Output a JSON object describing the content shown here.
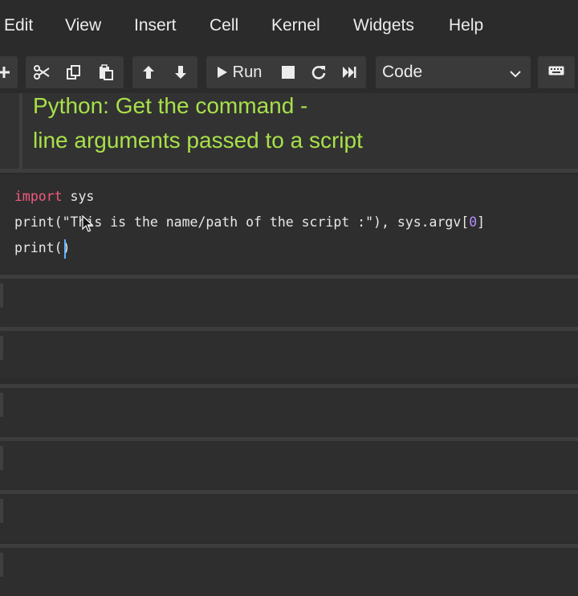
{
  "menubar": {
    "items": [
      {
        "label": "Edit"
      },
      {
        "label": "View"
      },
      {
        "label": "Insert"
      },
      {
        "label": "Cell"
      },
      {
        "label": "Kernel"
      },
      {
        "label": "Widgets"
      },
      {
        "label": "Help"
      }
    ]
  },
  "toolbar": {
    "icons": {
      "add": "plus-icon",
      "cut": "scissors-icon",
      "copy": "copy-icon",
      "paste": "paste-icon",
      "move_up": "arrow-up-icon",
      "move_down": "arrow-down-icon",
      "run": "play-icon",
      "interrupt": "stop-icon",
      "restart": "refresh-icon",
      "run_all": "fast-forward-icon",
      "keyboard": "keyboard-icon"
    },
    "run_label": "Run",
    "cell_type": "Code"
  },
  "notebook": {
    "markdown_cell": {
      "lines": [
        "Python: Get the command -",
        "line arguments passed to a script"
      ]
    },
    "code_cell": {
      "line1": {
        "keyword": "import",
        "rest": " sys"
      },
      "line2": {
        "prefix": "print(\"This is the name/path of the script :\"), sys.argv[",
        "index": "0",
        "suffix": "]"
      },
      "line3": {
        "text": "print()"
      }
    }
  },
  "colors": {
    "background": "#2b2b2b",
    "markdown_heading": "#a8e04a",
    "keyword": "#f25a7f",
    "number": "#b58cff",
    "caret": "#5fb4ff"
  }
}
